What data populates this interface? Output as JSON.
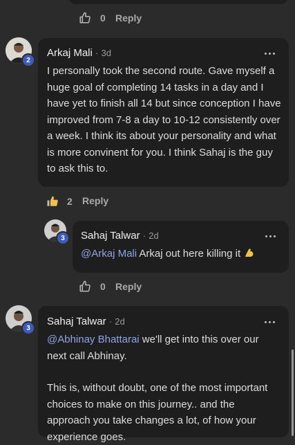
{
  "top_actions": {
    "count": "0",
    "reply": "Reply"
  },
  "comments": [
    {
      "name": "Arkaj Mali",
      "time": "3d",
      "badge": "2",
      "text": "I personally took the second route. Gave myself a huge goal of completing 14 tasks in a day and I have yet to finish all 14 but since conception I have improved from 7-8 a day to 10-12 consistently over a week. I think its about your personality and what is more convinent for you. I think Sahaj is the guy to ask this to.",
      "likes": "2",
      "reply": "Reply"
    },
    {
      "name": "Sahaj Talwar",
      "time": "2d",
      "badge": "3",
      "mention": "@Arkaj Mali",
      "text": " Arkaj out here killing it ",
      "emoji": "flexed-biceps",
      "likes": "0",
      "reply": "Reply"
    },
    {
      "name": "Sahaj Talwar",
      "time": "2d",
      "badge": "3",
      "mention": "@Abhinay Bhattarai",
      "text": " we'll get into this over our next call Abhinay.",
      "text2": "This is, without doubt, one of the most important choices to make on this journey.. and the approach you take changes a lot, of how your experience goes."
    }
  ],
  "separator": "·",
  "colors": {
    "background": "#2b2b2b",
    "card": "#1e1e1e",
    "mention": "#8fa6e6",
    "badge": "#3d5bb8",
    "liked": "#f0c24b"
  }
}
